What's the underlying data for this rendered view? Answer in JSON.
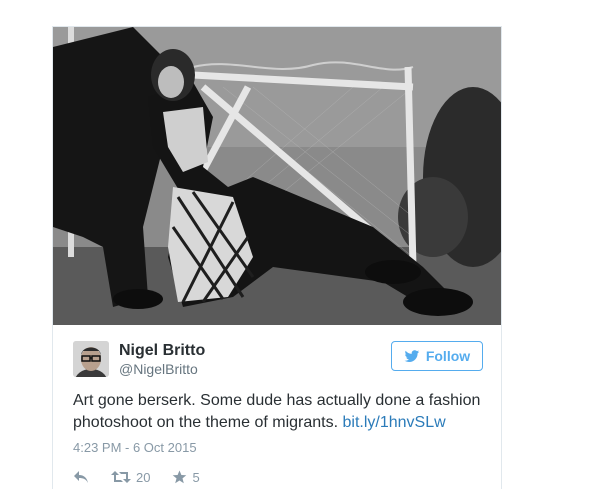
{
  "tweet": {
    "author_name": "Nigel Britto",
    "author_handle": "@NigelBritto",
    "follow_label": "Follow",
    "text": "Art gone berserk. Some dude has actually done a fashion photoshoot on the theme of migrants.",
    "link": "bit.ly/1hnvSLw",
    "timestamp": "4:23 PM - 6 Oct 2015",
    "retweet_count": "20",
    "like_count": "5"
  },
  "icons": {
    "follow": "bird-icon",
    "reply": "reply-icon",
    "retweet": "retweet-icon",
    "like": "star-icon"
  },
  "colors": {
    "brand": "#55acee",
    "link": "#2b7bb9",
    "meta": "#8899a6"
  }
}
